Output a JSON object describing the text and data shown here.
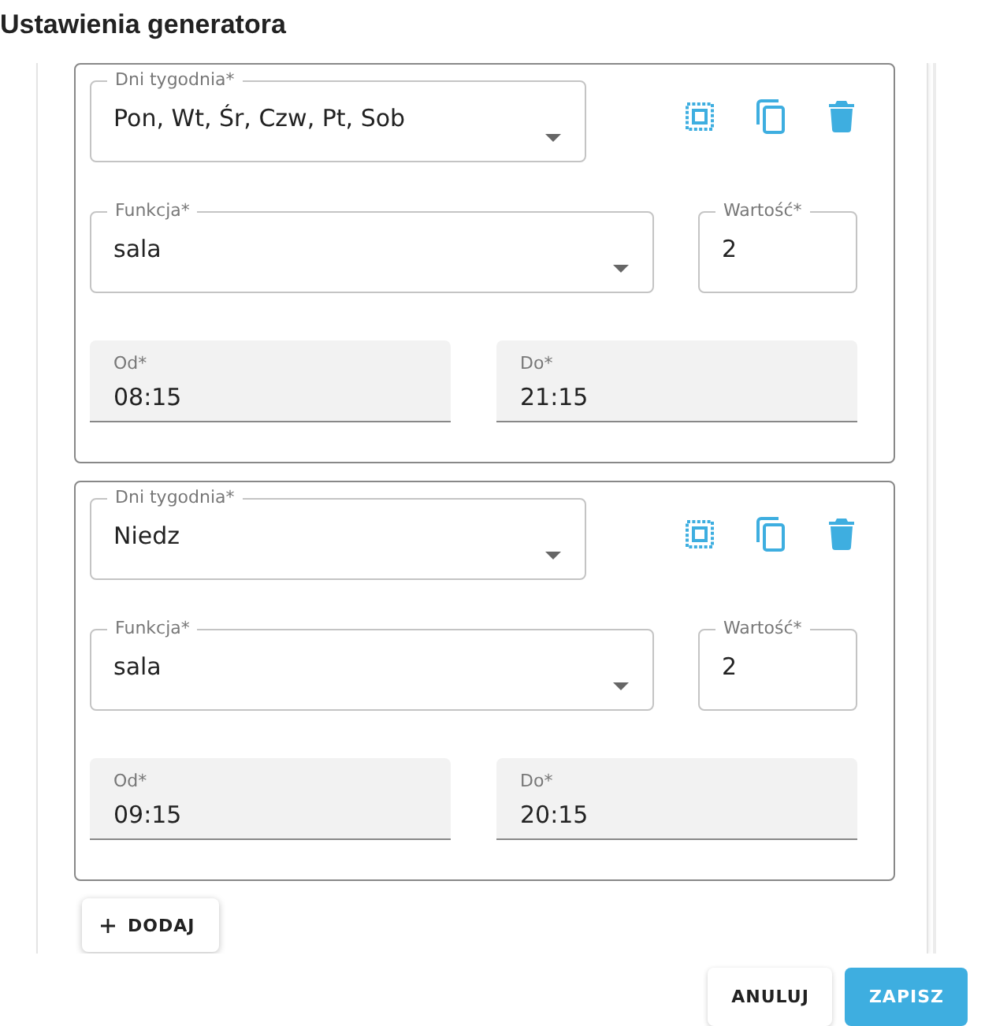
{
  "title": "Ustawienia generatora",
  "cards": [
    {
      "days": {
        "label": "Dni tygodnia*",
        "value": "Pon, Wt, Śr, Czw, Pt, Sob"
      },
      "function": {
        "label": "Funkcja*",
        "value": "sala"
      },
      "amount": {
        "label": "Wartość*",
        "value": "2"
      },
      "from": {
        "label": "Od*",
        "value": "08:15"
      },
      "to": {
        "label": "Do*",
        "value": "21:15"
      }
    },
    {
      "days": {
        "label": "Dni tygodnia*",
        "value": "Niedz"
      },
      "function": {
        "label": "Funkcja*",
        "value": "sala"
      },
      "amount": {
        "label": "Wartość*",
        "value": "2"
      },
      "from": {
        "label": "Od*",
        "value": "09:15"
      },
      "to": {
        "label": "Do*",
        "value": "20:15"
      }
    }
  ],
  "add_button": "DODAJ",
  "footer_buttons": [
    {
      "label": "ANULUJ",
      "kind": "text"
    },
    {
      "label": "ZAPISZ",
      "kind": "primary"
    }
  ]
}
